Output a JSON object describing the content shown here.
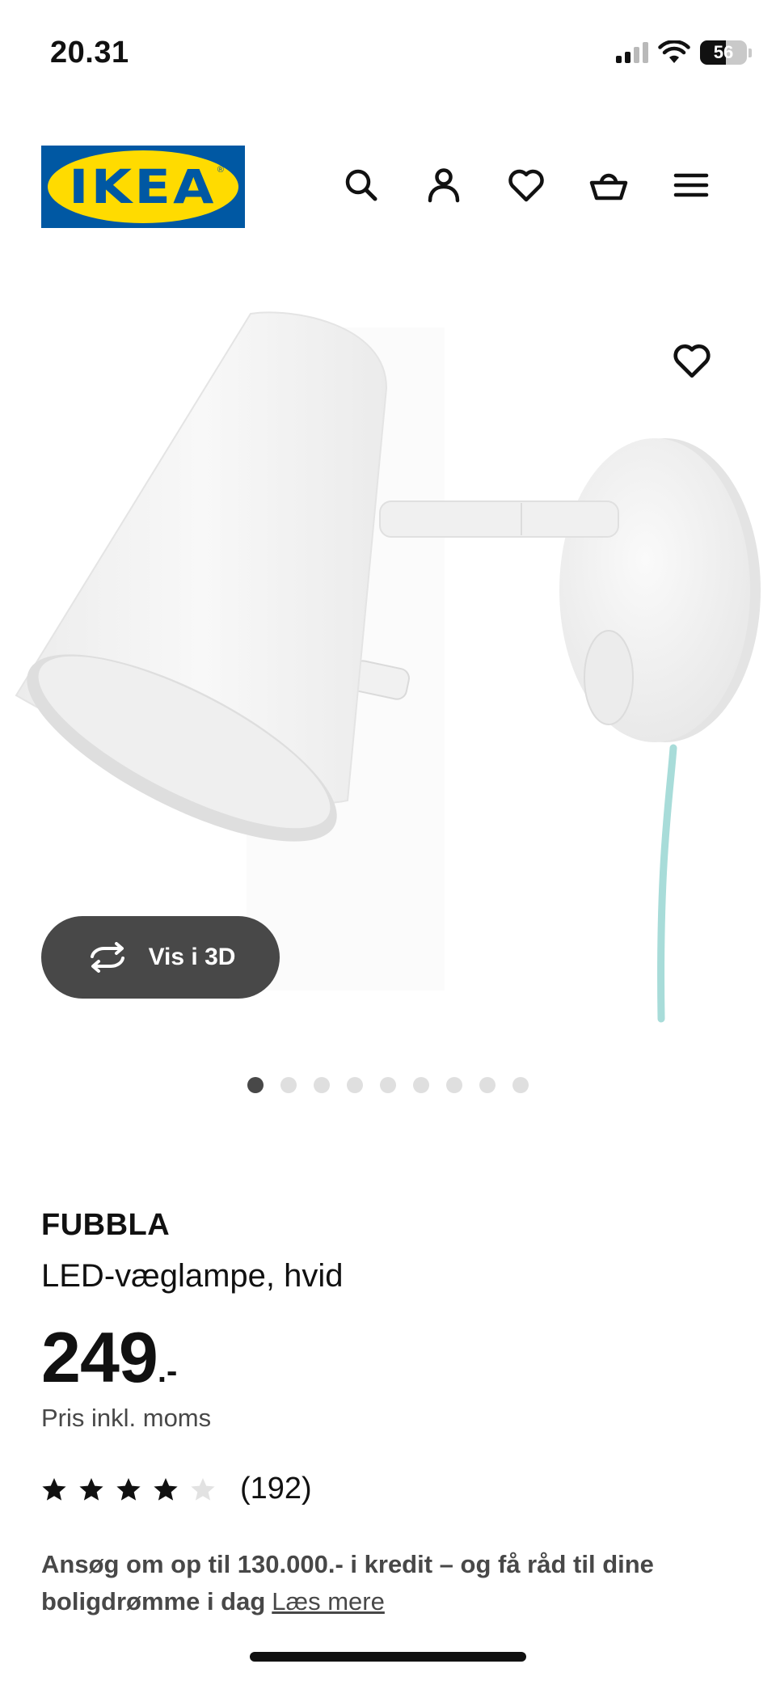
{
  "status_bar": {
    "time": "20.31",
    "battery": "56",
    "signal_icon": "cellular-signal-icon",
    "wifi_icon": "wifi-icon"
  },
  "header": {
    "logo_text": "IKEA",
    "icons": [
      "search-icon",
      "account-icon",
      "heart-icon",
      "basket-icon",
      "menu-icon"
    ]
  },
  "gallery": {
    "view_3d_label": "Vis i 3D",
    "image_count": 9,
    "active_index": 0
  },
  "product": {
    "name": "FUBBLA",
    "description": "LED-væglampe, hvid",
    "price": "249",
    "price_suffix": ".-",
    "vat_note": "Pris inkl. moms",
    "rating": 4,
    "rating_max": 5,
    "review_count": "(192)"
  },
  "credit": {
    "text": "Ansøg om op til 130.000.- i kredit – og få råd til dine boligdrømme i dag",
    "link_label": "Læs mere"
  },
  "colors": {
    "brand_blue": "#0058a3",
    "brand_yellow": "#ffdb00",
    "button_dark": "#484848",
    "cord": "#a8dcd9"
  }
}
